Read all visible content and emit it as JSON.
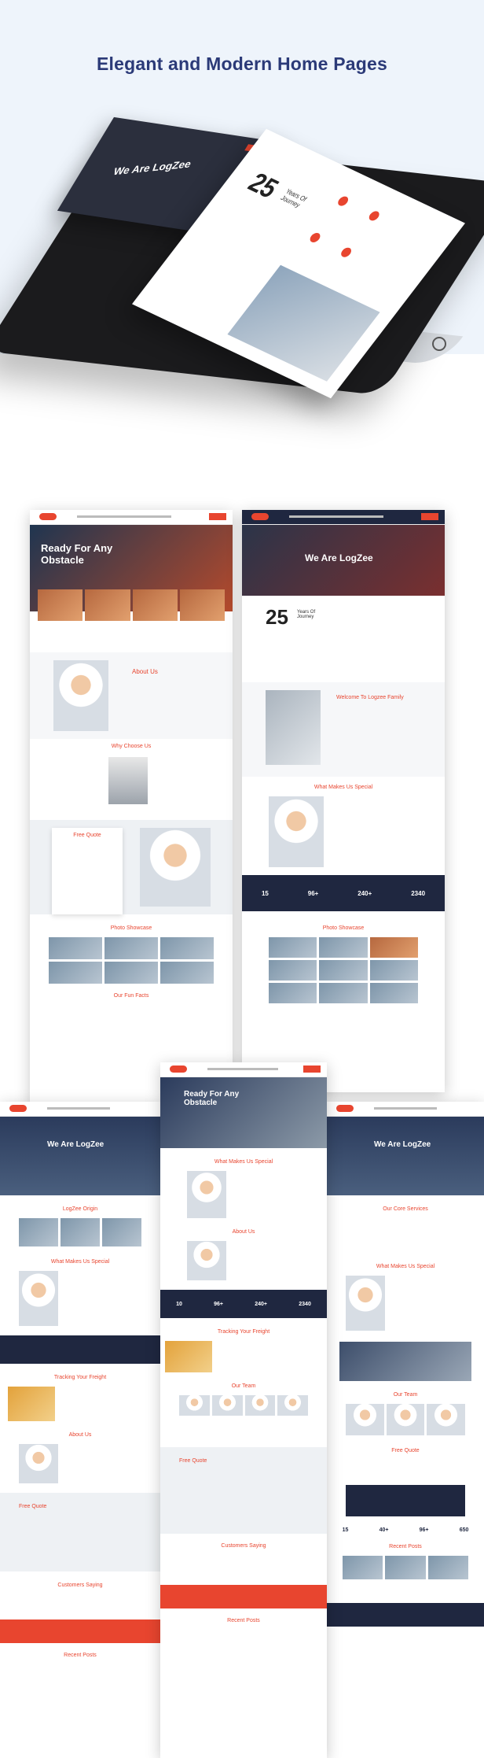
{
  "headline": "Elegant and Modern Home Pages",
  "mock1": {
    "hero_title": "Ready For Any Obstacle",
    "about": "About Us",
    "why": "Why Choose Us",
    "quote": "Free Quote",
    "showcase": "Photo Showcase",
    "facts": "Our Fun Facts"
  },
  "mock2": {
    "hero_title": "We Are LogZee",
    "years": "25",
    "years_label": "Years Of Journey",
    "welcome": "Welcome To Logzee Family",
    "special": "What Makes Us Special",
    "showcase": "Photo Showcase",
    "stats": [
      "15",
      "96+",
      "240+",
      "2340"
    ]
  },
  "mock3": {
    "hero_title": "We Are LogZee",
    "origin": "LogZee Origin",
    "special": "What Makes Us Special",
    "tracking": "Tracking Your Freight",
    "about": "About Us",
    "quote": "Free Quote",
    "testimonials": "Customers Saying",
    "posts": "Recent Posts"
  },
  "mock4": {
    "hero_title": "Ready For Any Obstacle",
    "special": "What Makes Us Special",
    "about": "About Us",
    "stats": [
      "10",
      "96+",
      "240+",
      "2340"
    ],
    "tracking": "Tracking Your Freight",
    "team": "Our Team",
    "quote": "Free Quote",
    "testimonials": "Customers Saying",
    "posts": "Recent Posts"
  },
  "mock5": {
    "hero_title": "We Are LogZee",
    "services": "Our Core Services",
    "special": "What Makes Us Special",
    "team": "Our Team",
    "quote": "Free Quote",
    "stats": [
      "15",
      "40+",
      "96+",
      "650"
    ],
    "posts": "Recent Posts"
  },
  "tablet": {
    "sheet_title": "We Are LogZee",
    "years": "25",
    "years_label": "Years Of Journey"
  }
}
